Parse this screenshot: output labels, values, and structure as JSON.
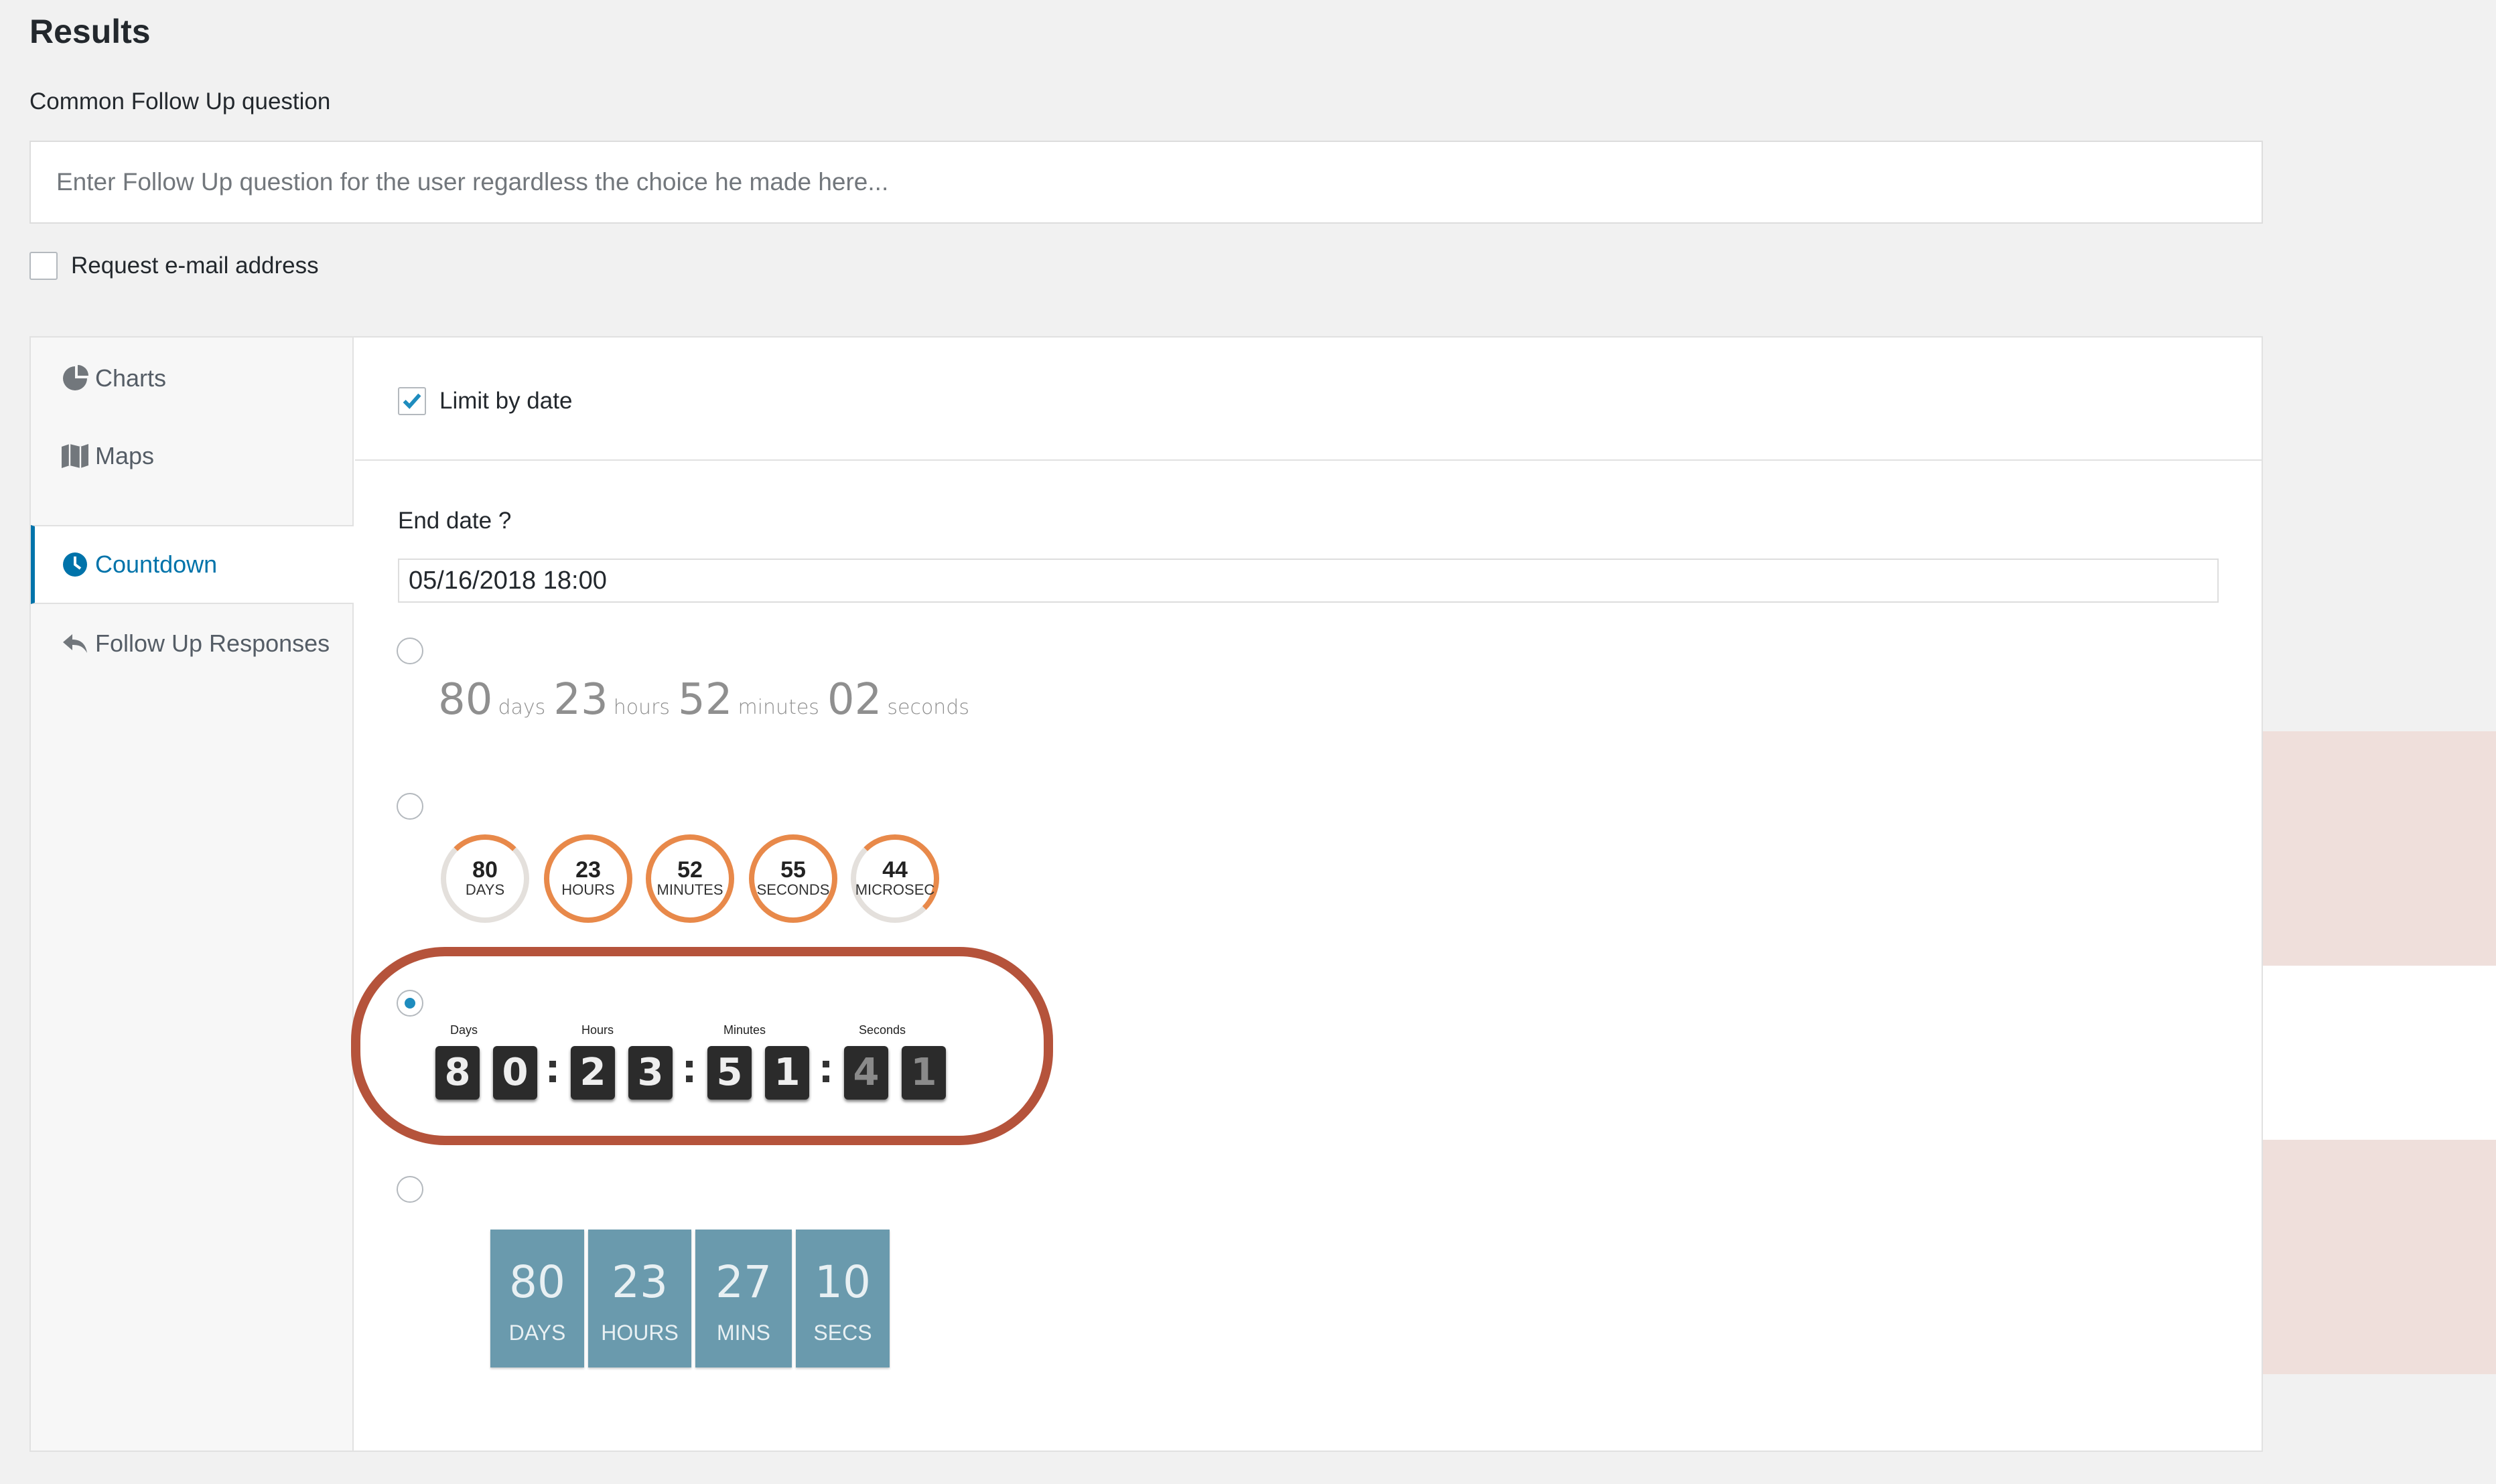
{
  "page": {
    "title": "Results",
    "follow_up_label": "Common Follow Up question",
    "follow_up_placeholder": "Enter Follow Up question for the user regardless the choice he made here...",
    "request_email_label": "Request e-mail address"
  },
  "sidebar": {
    "items": [
      {
        "label": "Charts",
        "icon": "pie-chart-icon"
      },
      {
        "label": "Maps",
        "icon": "map-icon"
      },
      {
        "label": "Countdown",
        "icon": "clock-icon",
        "active": true
      },
      {
        "label": "Follow Up Responses",
        "icon": "reply-icon"
      }
    ]
  },
  "countdown": {
    "limit_by_date_label": "Limit by date",
    "limit_by_date_checked": true,
    "end_date_label": "End date ?",
    "end_date_value": "05/16/2018 18:00",
    "selected_style": 3,
    "style1": {
      "days": "80",
      "days_unit": "days",
      "hours": "23",
      "hours_unit": "hours",
      "minutes": "52",
      "minutes_unit": "minutes",
      "seconds": "02",
      "seconds_unit": "seconds"
    },
    "style2": [
      {
        "value": "80",
        "label": "DAYS"
      },
      {
        "value": "23",
        "label": "HOURS"
      },
      {
        "value": "52",
        "label": "MINUTES"
      },
      {
        "value": "55",
        "label": "SECONDS"
      },
      {
        "value": "44",
        "label": "MICROSEC"
      }
    ],
    "style3": {
      "labels": {
        "days": "Days",
        "hours": "Hours",
        "minutes": "Minutes",
        "seconds": "Seconds"
      },
      "digits": [
        "8",
        "0",
        "2",
        "3",
        "5",
        "1",
        "4",
        "1"
      ]
    },
    "style4": [
      {
        "value": "80",
        "label": "DAYS"
      },
      {
        "value": "23",
        "label": "HOURS"
      },
      {
        "value": "27",
        "label": "MINS"
      },
      {
        "value": "10",
        "label": "SECS"
      }
    ]
  },
  "colors": {
    "accent": "#0073aa",
    "circle_ring": "#e8894a",
    "box_bg": "#6a9aad",
    "highlight_ring": "#b5533b",
    "highlight_band": "#efdfdb"
  }
}
